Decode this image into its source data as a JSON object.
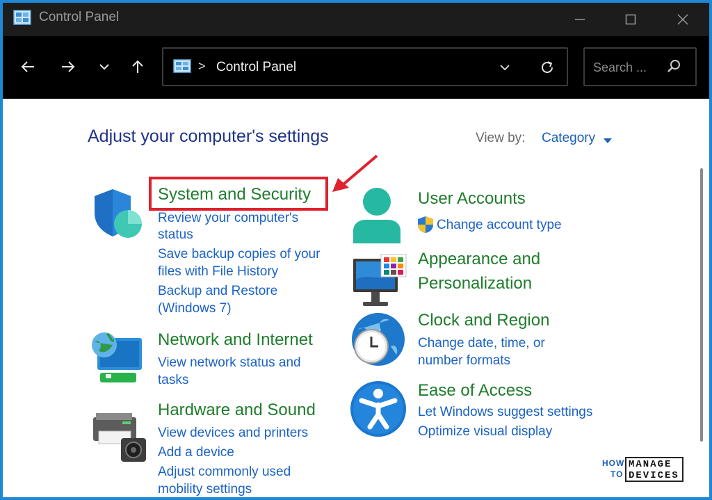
{
  "window": {
    "title": "Control Panel"
  },
  "navigation": {
    "breadcrumb_separator": ">",
    "address_text": "Control Panel",
    "search_placeholder": "Search ..."
  },
  "content": {
    "heading": "Adjust your computer's settings",
    "view_by_label": "View by:",
    "view_by_value": "Category"
  },
  "categories_left": [
    {
      "title": "System and Security",
      "icon": "shield-icon",
      "links": [
        "Review your computer's",
        "status",
        "Save backup copies of your",
        "files with File History",
        "Backup and Restore",
        "(Windows 7)"
      ]
    },
    {
      "title": "Network and Internet",
      "icon": "network-globe-icon",
      "links": [
        "View network status and",
        "tasks"
      ]
    },
    {
      "title": "Hardware and Sound",
      "icon": "printer-speaker-icon",
      "links": [
        "View devices and printers",
        "Add a device",
        "Adjust commonly used",
        "mobility settings"
      ]
    }
  ],
  "categories_right": [
    {
      "title": "User Accounts",
      "icon": "user-icon",
      "links": [
        "Change account type"
      ]
    },
    {
      "title_lines": [
        "Appearance and",
        "Personalization"
      ],
      "icon": "monitor-palette-icon",
      "links": []
    },
    {
      "title": "Clock and Region",
      "icon": "clock-globe-icon",
      "links": [
        "Change date, time, or",
        "number formats"
      ]
    },
    {
      "title": "Ease of Access",
      "icon": "accessibility-icon",
      "links": [
        "Let Windows suggest settings",
        "Optimize visual display"
      ]
    }
  ],
  "watermark": {
    "line1_left": "HOW",
    "line2_left": "TO",
    "line1_right": "MANAGE",
    "line2_right": "DEVICES"
  },
  "colors": {
    "heading": "#1e3287",
    "category_title": "#1f7d2c",
    "link": "#1a62c4",
    "highlight": "#e0212e",
    "border": "#1e88d6"
  }
}
